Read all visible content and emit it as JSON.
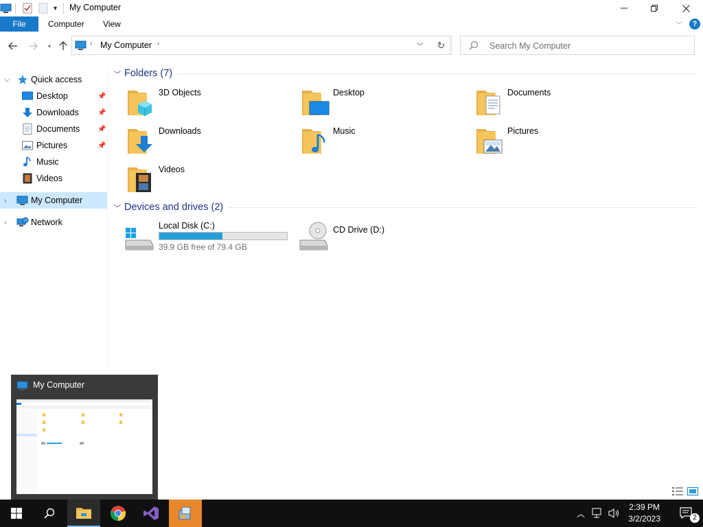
{
  "window": {
    "title": "My Computer"
  },
  "ribbon": {
    "tabs": [
      {
        "label": "File"
      },
      {
        "label": "Computer"
      },
      {
        "label": "View"
      }
    ]
  },
  "address": {
    "path": "My Computer",
    "search_placeholder": "Search My Computer"
  },
  "sidebar": {
    "quick_access": "Quick access",
    "items": [
      {
        "label": "Desktop",
        "pinned": true
      },
      {
        "label": "Downloads",
        "pinned": true
      },
      {
        "label": "Documents",
        "pinned": true
      },
      {
        "label": "Pictures",
        "pinned": true
      },
      {
        "label": "Music",
        "pinned": false
      },
      {
        "label": "Videos",
        "pinned": false
      }
    ],
    "my_computer": "My Computer",
    "network": "Network"
  },
  "folders": {
    "header": "Folders (7)",
    "items": [
      {
        "name": "3D Objects",
        "icon": "3d-objects-folder-icon"
      },
      {
        "name": "Desktop",
        "icon": "desktop-folder-icon"
      },
      {
        "name": "Documents",
        "icon": "documents-folder-icon"
      },
      {
        "name": "Downloads",
        "icon": "downloads-folder-icon"
      },
      {
        "name": "Music",
        "icon": "music-folder-icon"
      },
      {
        "name": "Pictures",
        "icon": "pictures-folder-icon"
      },
      {
        "name": "Videos",
        "icon": "videos-folder-icon"
      }
    ]
  },
  "devices": {
    "header": "Devices and drives (2)",
    "drives": [
      {
        "name": "Local Disk (C:)",
        "free_text": "39.9 GB free of 79.4 GB",
        "used_fraction": 0.497
      },
      {
        "name": "CD Drive (D:)"
      }
    ]
  },
  "thumbnail": {
    "title": "My Computer"
  },
  "taskbar": {
    "time": "2:39 PM",
    "date": "3/2/2023",
    "notification_count": "2"
  },
  "colors": {
    "accent": "#1979ca",
    "selection": "#cce8ff",
    "group_header": "#1e3287",
    "drive_bar": "#26a0da",
    "folder": "#f5c55b",
    "taskbar": "#101010"
  }
}
